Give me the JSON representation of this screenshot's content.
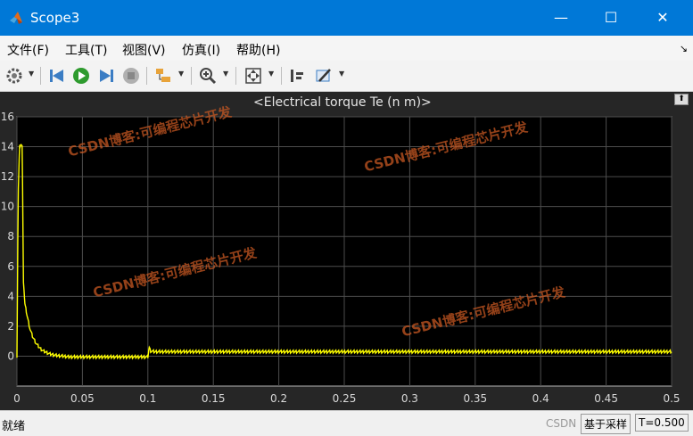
{
  "window": {
    "title": "Scope3",
    "minimize": "—",
    "maximize": "☐",
    "close": "✕"
  },
  "menu": [
    {
      "label": "文件(F)"
    },
    {
      "label": "工具(T)"
    },
    {
      "label": "视图(V)"
    },
    {
      "label": "仿真(I)"
    },
    {
      "label": "帮助(H)"
    }
  ],
  "menu_arrow": "↘",
  "toolbar": {
    "icons": [
      "gear-icon",
      "step-back-icon",
      "run-icon",
      "step-forward-icon",
      "stop-icon",
      "highlight-icon",
      "zoom-in-icon",
      "fit-to-view-icon",
      "cursor-measure-icon",
      "style-pen-icon"
    ]
  },
  "plot": {
    "expand_label": "⬆"
  },
  "watermarks": [
    {
      "text": "CSDN博客:可编程芯片开发"
    },
    {
      "text": "CSDN博客:可编程芯片开发"
    },
    {
      "text": "CSDN博客:可编程芯片开发"
    },
    {
      "text": "CSDN博客:可编程芯片开发"
    }
  ],
  "status": {
    "text": "就绪",
    "watermark": "CSDN",
    "mode": "基于采样",
    "time": "T=0.500"
  },
  "colors": {
    "plot_bg": "#262626",
    "axes_bg": "#000000",
    "grid": "#4d4d4d",
    "line": "#ffff00",
    "title_bar": "#0078d7"
  },
  "chart_data": {
    "type": "line",
    "title": "<Electrical torque Te (n m)>",
    "xlabel": "",
    "ylabel": "",
    "xlim": [
      0,
      0.5
    ],
    "ylim": [
      -2,
      16
    ],
    "xticks": [
      0,
      0.05,
      0.1,
      0.15,
      0.2,
      0.25,
      0.3,
      0.35,
      0.4,
      0.45,
      0.5
    ],
    "xtick_labels": [
      "0",
      "0.05",
      "0.1",
      "0.15",
      "0.2",
      "0.25",
      "0.3",
      "0.35",
      "0.4",
      "0.45",
      "0.5"
    ],
    "yticks": [
      0,
      2,
      4,
      6,
      8,
      10,
      12,
      14,
      16
    ],
    "ytick_labels": [
      "0",
      "2",
      "4",
      "6",
      "8",
      "10",
      "12",
      "14",
      "16"
    ],
    "grid": true,
    "series": [
      {
        "color": "#ffff00",
        "x": [
          0,
          0.001,
          0.002,
          0.003,
          0.004,
          0.005,
          0.006,
          0.008,
          0.01,
          0.012,
          0.015,
          0.018,
          0.02,
          0.025,
          0.03,
          0.035,
          0.04,
          0.05,
          0.06,
          0.08,
          0.1,
          0.101,
          0.102,
          0.105,
          0.12,
          0.2,
          0.3,
          0.4,
          0.5
        ],
        "y": [
          0,
          11,
          14,
          14.2,
          14,
          5,
          3.5,
          2.6,
          1.8,
          1.3,
          0.8,
          0.5,
          0.35,
          0.15,
          0.05,
          0,
          -0.05,
          -0.05,
          -0.05,
          -0.05,
          -0.05,
          0.6,
          0.35,
          0.3,
          0.3,
          0.3,
          0.3,
          0.3,
          0.3
        ]
      }
    ],
    "noise_band": 0.1
  }
}
